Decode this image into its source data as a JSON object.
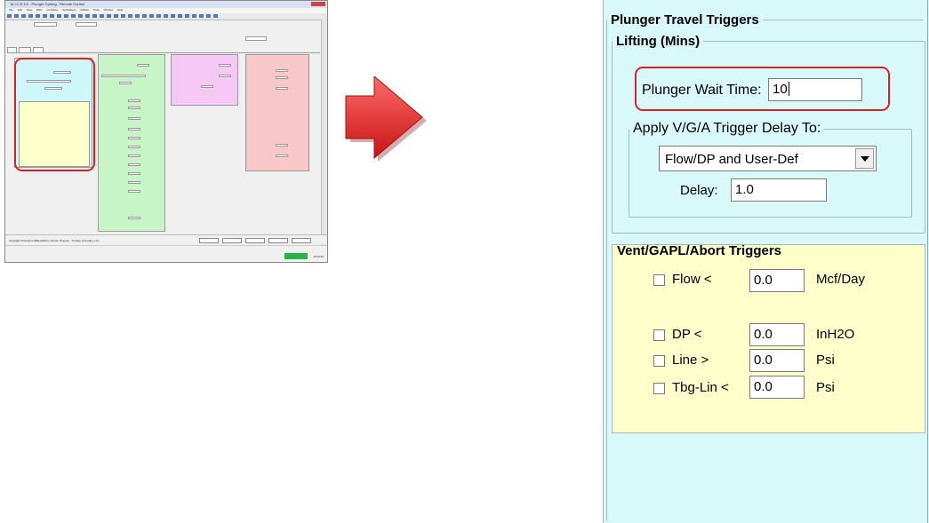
{
  "thumbnail": {
    "title": "M.I.C.E 6.0 - Plunger Cycling - Remote Control",
    "menu": [
      "File",
      "Edit",
      "View",
      "RDC",
      "Configure",
      "Spc/Meters",
      "Utilities",
      "Tools",
      "Window",
      "Help"
    ],
    "status_text": "Copyright Protected 1996-2016 by Vernon Process · Turnkey Company, LLC",
    "time": "16:33:46"
  },
  "panel": {
    "title": "Plunger Travel Triggers",
    "lifting": {
      "title": "Lifting (Mins)",
      "wait_label": "Plunger Wait Time:",
      "wait_value": "10"
    },
    "vga": {
      "title": "Apply V/G/A Trigger Delay To:",
      "selected": "Flow/DP and User-Def",
      "delay_label": "Delay:",
      "delay_value": "1.0"
    },
    "vent": {
      "title": "Vent/GAPL/Abort Triggers",
      "rows": [
        {
          "label": "Flow <",
          "value": "0.0",
          "unit": "Mcf/Day"
        },
        {
          "label": "DP <",
          "value": "0.0",
          "unit": "InH2O"
        },
        {
          "label": "Line >",
          "value": "0.0",
          "unit": "Psi"
        },
        {
          "label": "Tbg-Lin <",
          "value": "0.0",
          "unit": "Psi"
        }
      ]
    }
  },
  "colors": {
    "panel_bg": "#d8f8fa",
    "vent_bg": "#ffffcc",
    "highlight": "#e02020",
    "arrow": "#e03030"
  }
}
